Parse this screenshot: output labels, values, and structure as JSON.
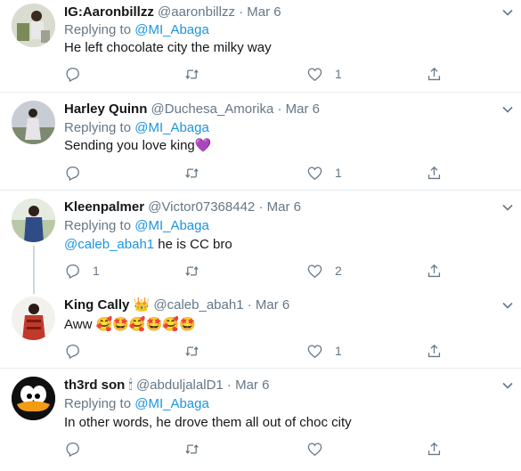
{
  "tweets": [
    {
      "name": "IG:Aaronbillzz",
      "handle": "@aaronbillzz",
      "date": "· Mar 6",
      "replying_prefix": "Replying to",
      "replying_to": "@MI_Abaga",
      "text": "He left chocolate city the milky way",
      "likes": "1"
    },
    {
      "name": "Harley Quinn",
      "handle": "@Duchesa_Amorika",
      "date": "· Mar 6",
      "replying_prefix": "Replying to",
      "replying_to": "@MI_Abaga",
      "text": "Sending you love king",
      "emoji": "💜",
      "likes": "1"
    },
    {
      "name": "Kleenpalmer",
      "handle": "@Victor07368442",
      "date": "· Mar 6",
      "replying_prefix": "Replying to",
      "replying_to": "@MI_Abaga",
      "mention": "@caleb_abah1",
      "text": " he is CC bro",
      "replies": "1",
      "likes": "2"
    },
    {
      "name": "King Cally",
      "name_emoji": "👑",
      "handle": "@caleb_abah1",
      "date": "· Mar 6",
      "text": "Aww",
      "emojis": "🥰🤩🥰🤩🥰🤩",
      "likes": "1"
    },
    {
      "name": "th3rd son",
      "name_emoji": "🕯",
      "handle": "@abduljalalD1",
      "date": "· Mar 6",
      "replying_prefix": "Replying to",
      "replying_to": "@MI_Abaga",
      "text": "In other words, he drove them all out of choc city"
    }
  ],
  "colors": {
    "accent": "#1b95e0",
    "muted": "#657786",
    "divider": "#e6ecf0"
  }
}
